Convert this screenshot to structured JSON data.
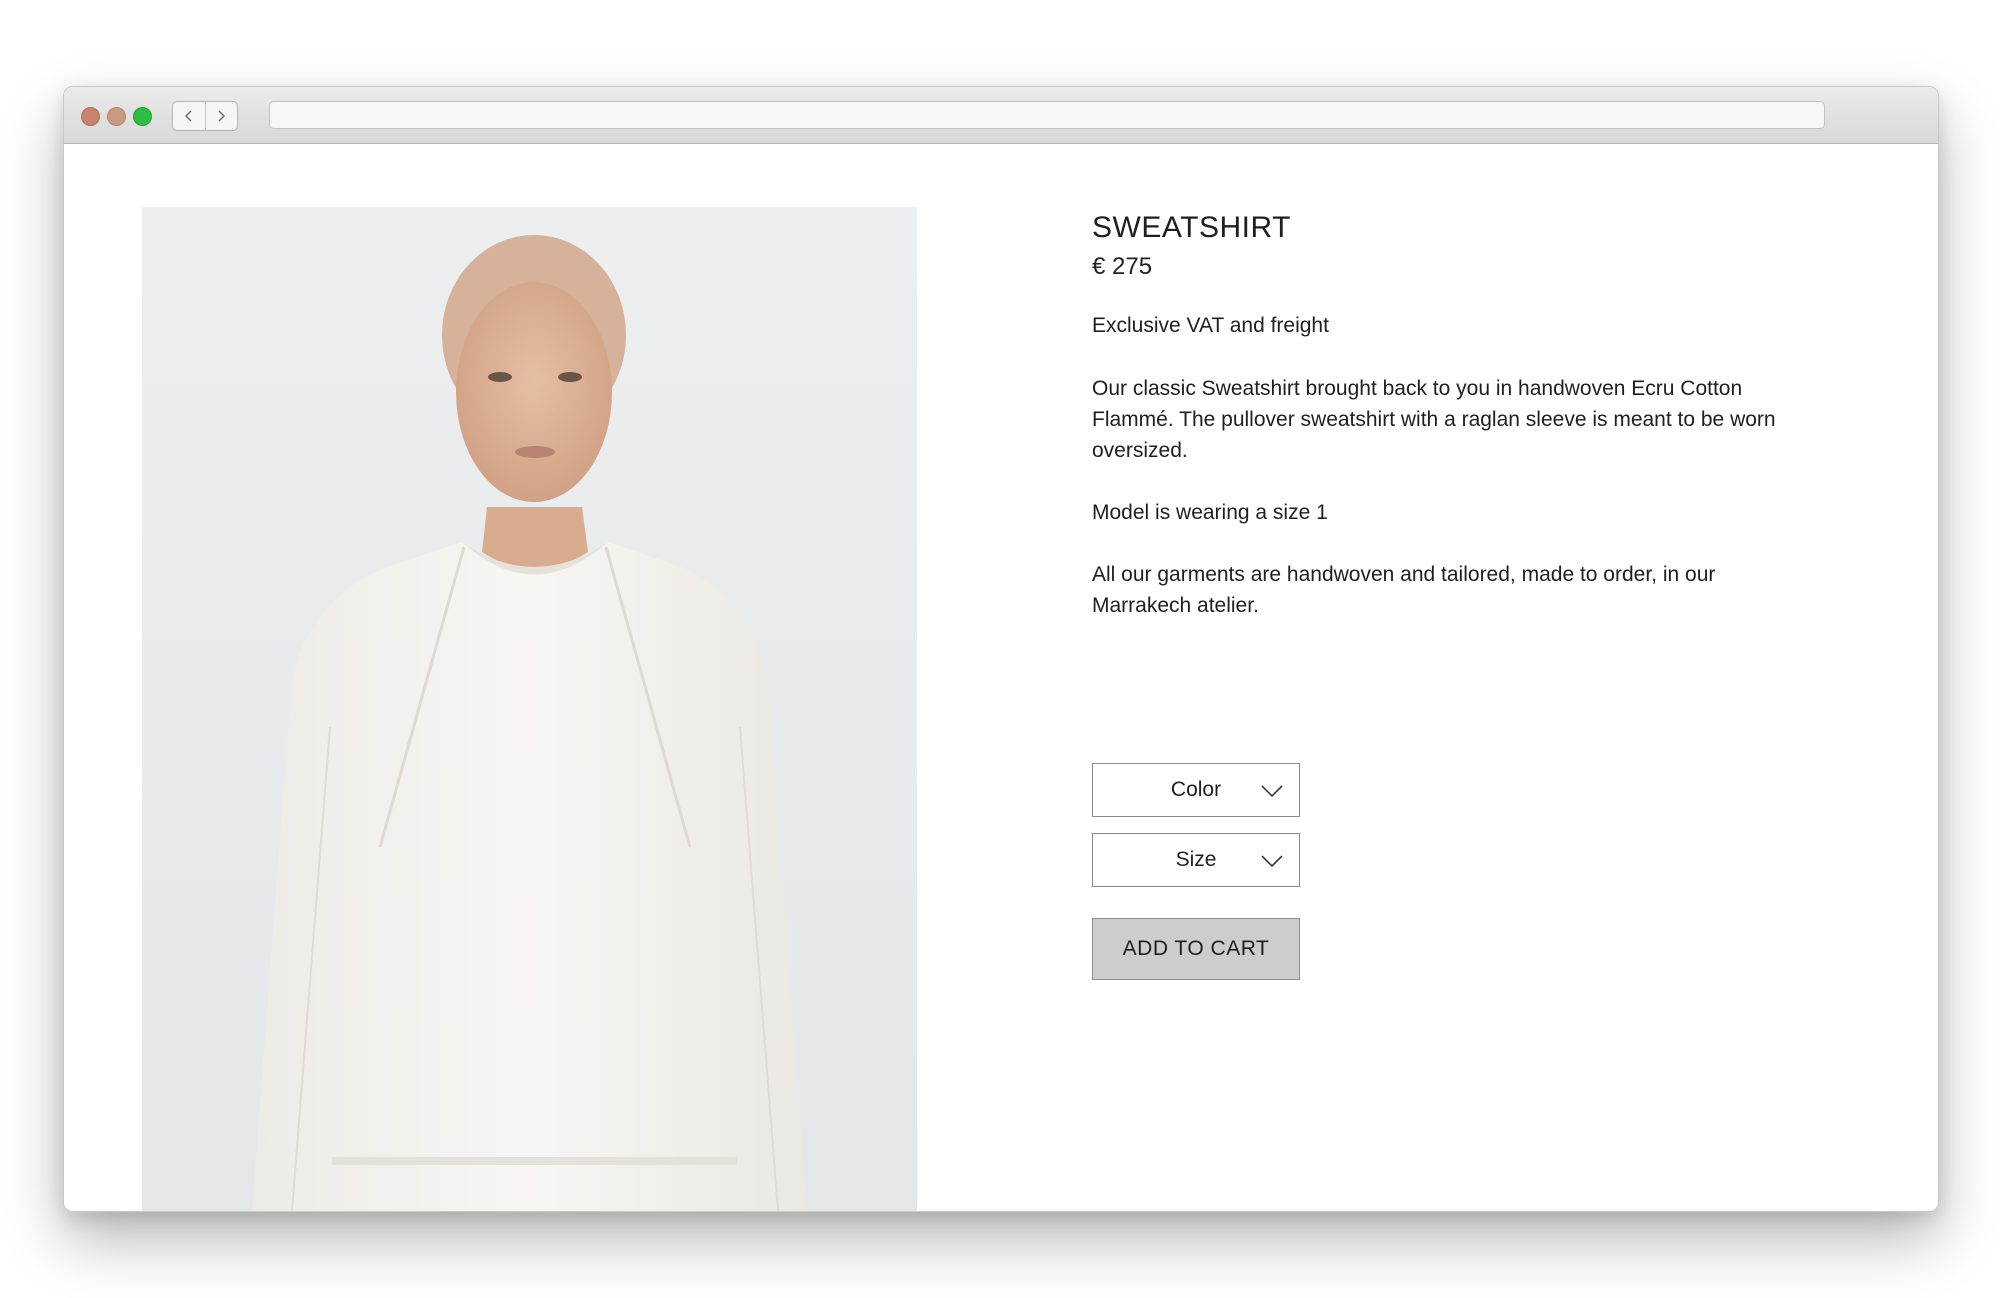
{
  "browser": {
    "address_value": "",
    "icons": {
      "close": "close-dot",
      "minimize": "minimize-dot",
      "zoom": "zoom-dot",
      "back": "chevron-left-icon",
      "forward": "chevron-right-icon"
    },
    "colors": {
      "close": "#c9826d",
      "minimize": "#c99a7d",
      "zoom": "#2fbd3f"
    }
  },
  "product": {
    "title": "SWEATSHIRT",
    "price": "€ 275",
    "vat_note": "Exclusive VAT and freight",
    "description": "Our classic Sweatshirt brought back to you in handwoven Ecru Cotton Flammé.  The pullover sweatshirt with a raglan sleeve is meant to be worn oversized.",
    "model_note": "Model is wearing a size 1",
    "atelier_note": "All our garments are handwoven and tailored, made to order, in our Marrakech atelier."
  },
  "options": {
    "color_label": "Color",
    "size_label": "Size"
  },
  "cart": {
    "add_label": "ADD TO CART"
  },
  "colors": {
    "button_bg": "#cdcdcd",
    "text": "#1f1f1f"
  }
}
